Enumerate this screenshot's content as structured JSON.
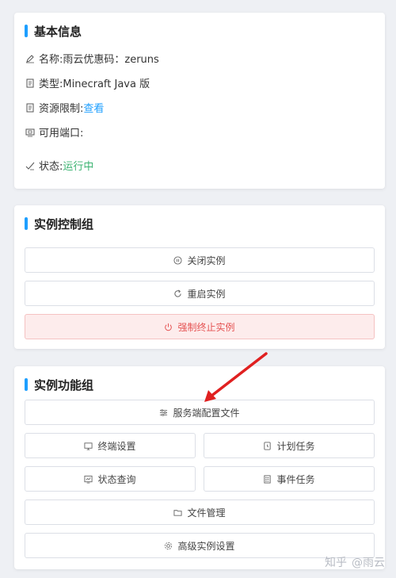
{
  "basic_info": {
    "title": "基本信息",
    "name_label": "名称: ",
    "name_value": "雨云优惠码：zeruns",
    "type_label": "类型: ",
    "type_value": "Minecraft Java 版",
    "resource_label": "资源限制: ",
    "resource_link": "查看",
    "port_label": "可用端口:",
    "status_label": "状态: ",
    "status_value": "运行中"
  },
  "control_group": {
    "title": "实例控制组",
    "stop_label": "关闭实例",
    "restart_label": "重启实例",
    "kill_label": "强制终止实例"
  },
  "function_group": {
    "title": "实例功能组",
    "server_config_label": "服务端配置文件",
    "terminal_settings_label": "终端设置",
    "scheduled_tasks_label": "计划任务",
    "status_query_label": "状态查询",
    "event_tasks_label": "事件任务",
    "file_manager_label": "文件管理",
    "advanced_settings_label": "高级实例设置"
  },
  "watermark": {
    "site": "知乎",
    "author": "@雨云"
  },
  "colors": {
    "accent": "#1e9fff",
    "running": "#3cb371",
    "danger": "#e55353",
    "annotation_arrow": "#e02020"
  }
}
